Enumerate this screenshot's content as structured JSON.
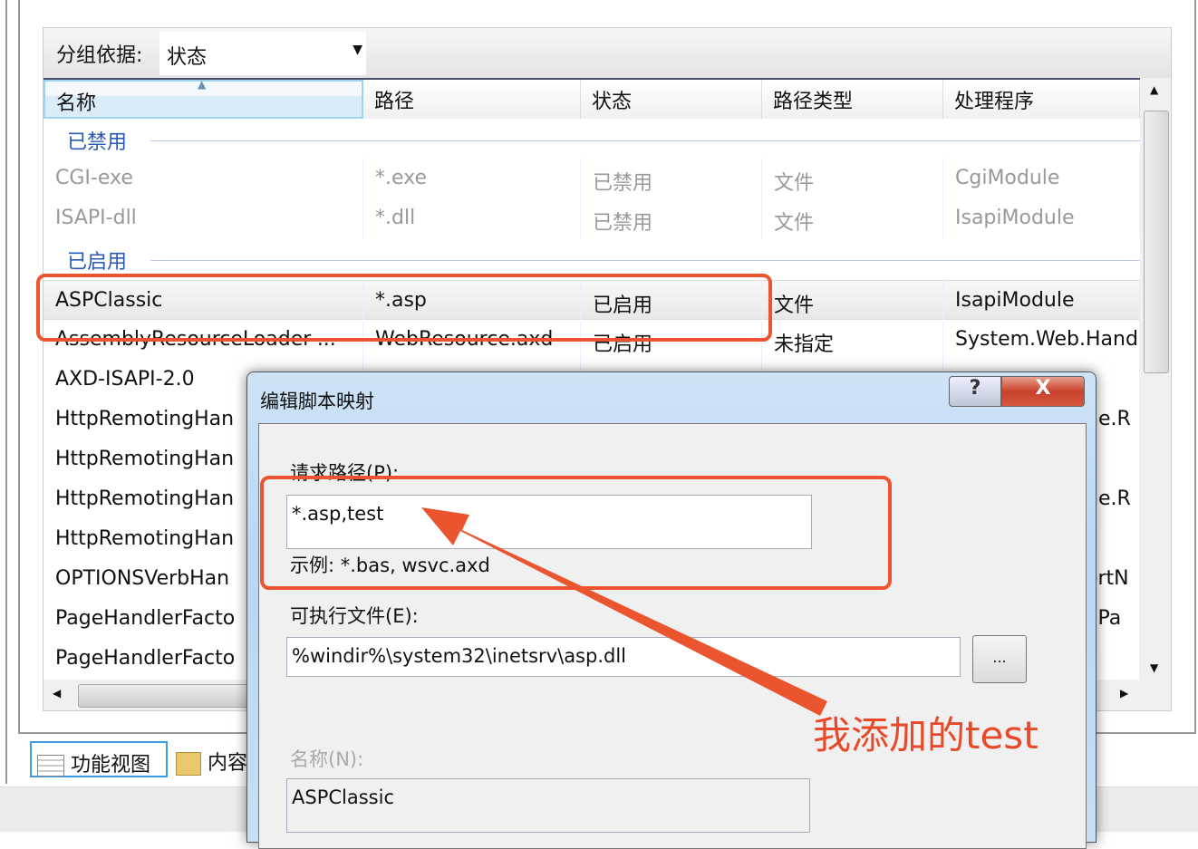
{
  "group_by": {
    "label": "分组依据:",
    "value": "状态"
  },
  "columns": [
    "名称",
    "路径",
    "状态",
    "路径类型",
    "处理程序"
  ],
  "groups": [
    {
      "label": "已禁用",
      "rows": [
        [
          "CGI-exe",
          "*.exe",
          "已禁用",
          "文件",
          "CgiModule"
        ],
        [
          "ISAPI-dll",
          "*.dll",
          "已禁用",
          "文件",
          "IsapiModule"
        ]
      ]
    },
    {
      "label": "已启用",
      "rows": [
        [
          "ASPClassic",
          "*.asp",
          "已启用",
          "文件",
          "IsapiModule"
        ],
        [
          "AssemblyResourceLoader-...",
          "WebResource.axd",
          "已启用",
          "未指定",
          "System.Web.Hand"
        ],
        [
          "AXD-ISAPI-2.0",
          "",
          "",
          "",
          ""
        ],
        [
          "HttpRemotingHan",
          "",
          "",
          "",
          "ne.R"
        ],
        [
          "HttpRemotingHan",
          "",
          "",
          "",
          ""
        ],
        [
          "HttpRemotingHan",
          "",
          "",
          "",
          "ne.R"
        ],
        [
          "HttpRemotingHan",
          "",
          "",
          "",
          ""
        ],
        [
          "OPTIONSVerbHan",
          "",
          "",
          "",
          "ortN"
        ],
        [
          "PageHandlerFacto",
          "",
          "",
          "",
          "I.Pa"
        ],
        [
          "PageHandlerFacto",
          "",
          "",
          "",
          ""
        ]
      ]
    }
  ],
  "tabs": {
    "features": "功能视图",
    "content": "内容"
  },
  "dialog": {
    "title": "编辑脚本映射",
    "help": "?",
    "close": "X",
    "request_path_label": "请求路径(P):",
    "request_path_value": "*.asp,test",
    "example": "示例: *.bas, wsvc.axd",
    "executable_label": "可执行文件(E):",
    "executable_value": "%windir%\\system32\\inetsrv\\asp.dll",
    "browse": "...",
    "name_label": "名称(N):",
    "name_value": "ASPClassic"
  },
  "annotation": {
    "text": "我添加的test",
    "color": "#ea5530"
  }
}
